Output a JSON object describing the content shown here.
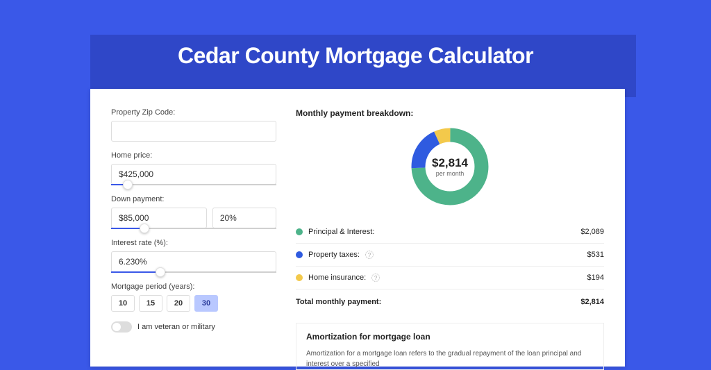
{
  "page_title": "Cedar County Mortgage Calculator",
  "form": {
    "zip_label": "Property Zip Code:",
    "zip_value": "",
    "home_price_label": "Home price:",
    "home_price_value": "$425,000",
    "home_price_slider_pct": 10,
    "down_payment_label": "Down payment:",
    "down_payment_value": "$85,000",
    "down_payment_pct_value": "20%",
    "down_payment_slider_pct": 20,
    "interest_label": "Interest rate (%):",
    "interest_value": "6.230%",
    "interest_slider_pct": 30,
    "period_label": "Mortgage period (years):",
    "periods": [
      "10",
      "15",
      "20",
      "30"
    ],
    "period_active_index": 3,
    "veteran_label": "I am veteran or military"
  },
  "breakdown": {
    "title": "Monthly payment breakdown:",
    "center_amount": "$2,814",
    "center_sub": "per month",
    "items": [
      {
        "label": "Principal & Interest:",
        "amount": "$2,089",
        "color": "#4db38a",
        "info": false
      },
      {
        "label": "Property taxes:",
        "amount": "$531",
        "color": "#2f5be0",
        "info": true
      },
      {
        "label": "Home insurance:",
        "amount": "$194",
        "color": "#f3c94b",
        "info": true
      }
    ],
    "total_label": "Total monthly payment:",
    "total_amount": "$2,814"
  },
  "chart_data": {
    "type": "pie",
    "title": "Monthly payment breakdown",
    "series": [
      {
        "name": "Principal & Interest",
        "value": 2089,
        "color": "#4db38a"
      },
      {
        "name": "Property taxes",
        "value": 531,
        "color": "#2f5be0"
      },
      {
        "name": "Home insurance",
        "value": 194,
        "color": "#f3c94b"
      }
    ],
    "total": 2814,
    "center_label": "$2,814 per month"
  },
  "amortization": {
    "title": "Amortization for mortgage loan",
    "text": "Amortization for a mortgage loan refers to the gradual repayment of the loan principal and interest over a specified"
  }
}
